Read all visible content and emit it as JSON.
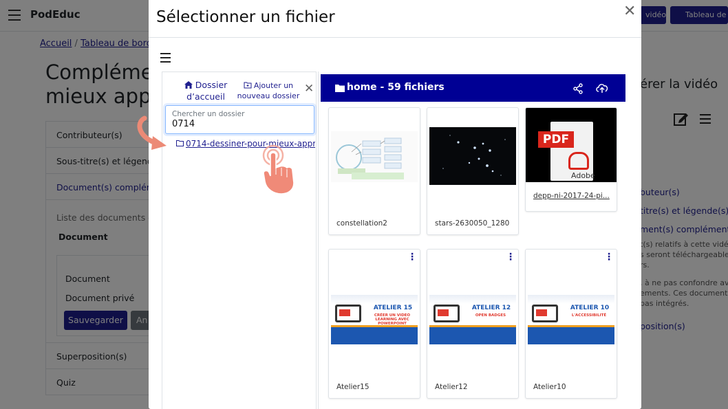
{
  "background": {
    "brand": "PodEduc",
    "top_buttons": [
      "vidéo",
      "Tableau de"
    ],
    "breadcrumb": [
      "Accueil",
      "Tableau de bord"
    ],
    "page_title_lines": [
      "Compléme",
      "mieux app"
    ],
    "accordion": {
      "items": [
        "Contributeur(s)",
        "Sous-titre(s) et légende",
        "Document(s) complém"
      ],
      "body_desc": "Liste des documents co",
      "body_bold": "Document",
      "label_document": "Document",
      "label_private": "Document privé",
      "save": "Sauvegarder",
      "cancel": "An",
      "items_after": [
        "Superposition(s)",
        "Quiz"
      ]
    },
    "right": {
      "title": "érer la vidéo",
      "links": [
        "buteur(s)",
        "titre(s) et légende(s)",
        "ment(s) complémentair"
      ],
      "text_lines": [
        "t(s) relatifs à cette vidéo",
        "s seront téléchargeables",
        "rs.",
        ", à ne pas confondre ave",
        "ements. Ces documents s",
        "pas intégrés."
      ],
      "link_last": "position(s)"
    }
  },
  "modal": {
    "title": "Sélectionner un fichier",
    "sidebar": {
      "home_label": "Dossier d’accueil",
      "add_folder_label": "Ajouter un nouveau dossier",
      "search_placeholder": "Chercher un dossier",
      "search_value": "0714",
      "result": "0714-dessiner-pour-mieux-appr"
    },
    "folder_bar": {
      "title": "home - 59 fichiers"
    },
    "files": [
      {
        "name": "constellation2"
      },
      {
        "name": "stars-2630050_1280"
      },
      {
        "name": "depp-ni-2017-24-pi...",
        "pdf_label": "PDF",
        "pdf_brand": "Adobe"
      },
      {
        "name": "Atelier15",
        "number": "ATELIER 15",
        "subtitle": "CRÉER UN VIDEO LEARNING AVEC POWERPOINT"
      },
      {
        "name": "Atelier12",
        "number": "ATELIER 12",
        "subtitle": "OPEN BADGES"
      },
      {
        "name": "Atelier10",
        "number": "ATELIER 10",
        "subtitle": "L'ACCESSIBILITÉ"
      }
    ]
  },
  "colors": {
    "primary": "#000094",
    "link": "#1f1f8f",
    "pdf_red": "#d9261c",
    "hand": "#f08a78"
  }
}
